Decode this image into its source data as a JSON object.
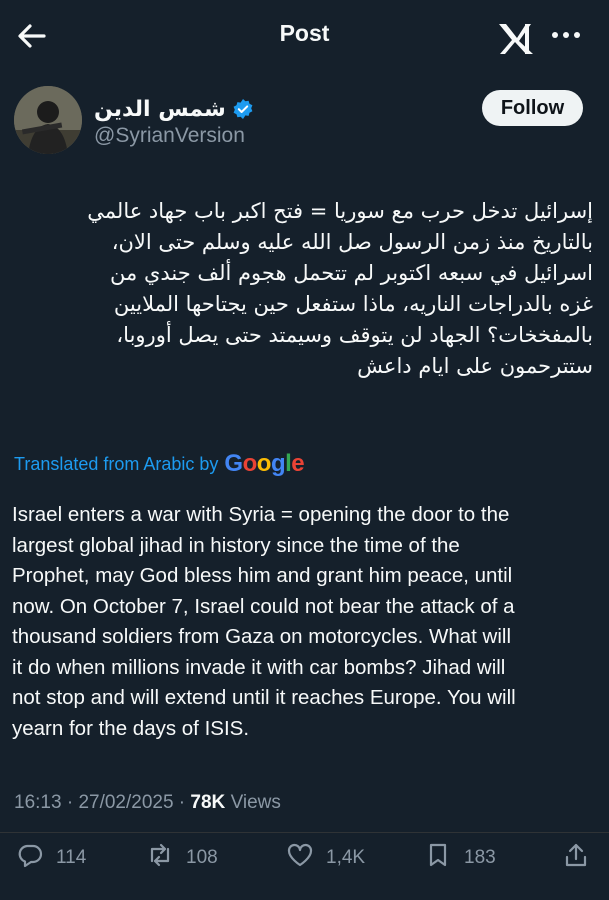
{
  "header": {
    "title": "Post"
  },
  "author": {
    "name": "شمس الدين",
    "handle": "@SyrianVersion",
    "follow_label": "Follow"
  },
  "post": {
    "arabic_lines": [
      "إسرائيل تدخل حرب مع سوريا = فتح اكبر باب جهاد عالمي",
      "بالتاريخ منذ زمن الرسول صل الله عليه وسلم حتى الان،",
      "اسرائيل في سبعه اكتوبر لم تتحمل هجوم ألف جندي من",
      "غزه بالدراجات الناريه، ماذا ستفعل حين يجتاحها الملايين",
      "بالمفخخات؟ الجهاد لن يتوقف وسيمتد حتى يصل أوروبا،",
      "ستترحمون على ايام داعش"
    ],
    "translated_label": "Translated from Arabic by",
    "translator_brand": "Google",
    "english_lines": [
      "Israel enters a war with Syria = opening the door to the",
      "largest global jihad in history since the time of the",
      "Prophet, may God bless him and grant him peace, until",
      "now. On October 7, Israel could not bear the attack of a",
      "thousand soldiers from Gaza on motorcycles. What will",
      "it do when millions invade it with car bombs? Jihad will",
      "not stop and will extend until it reaches Europe. You will",
      "yearn for the days of ISIS."
    ],
    "time": "16:13",
    "date": "27/02/2025",
    "views_count": "78K",
    "views_label": "Views"
  },
  "actions": {
    "replies": "114",
    "reposts": "108",
    "likes": "1,4K",
    "bookmarks": "183"
  },
  "colors": {
    "background": "#15202b",
    "text": "#f7f9f9",
    "muted": "#8b98a5",
    "accent": "#1d9bf0",
    "verified": "#1d9bf0"
  },
  "icons": [
    "back-arrow-icon",
    "x-logo-icon",
    "more-icon",
    "verified-badge-icon",
    "reply-icon",
    "repost-icon",
    "like-icon",
    "bookmark-icon",
    "share-icon"
  ]
}
